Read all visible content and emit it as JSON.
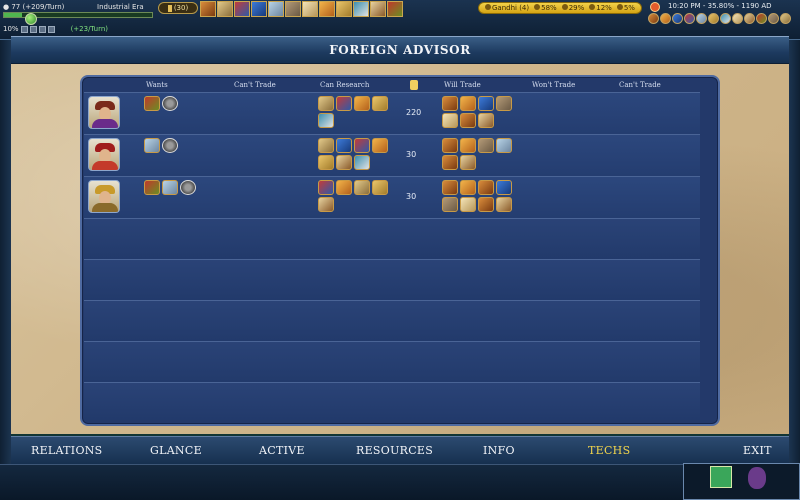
{
  "top_hud": {
    "gold_line": "77 (+209/Turn)",
    "era": "Industrial Era",
    "culture_percent": "10%",
    "culture_rate": "(+23/Turn)",
    "research_turns": "(30)",
    "resource_bar": {
      "civ": "Gandhi (4)",
      "gold_rate": "58%",
      "science_rate": "29%",
      "culture_rate": "12%",
      "espionage_rate": "5%"
    },
    "clock": "10:20 PM - 35.80% - 1190 AD"
  },
  "window": {
    "title": "FOREIGN ADVISOR"
  },
  "headers": {
    "wants": "Wants",
    "cant_trade": "Can't Trade",
    "can_research": "Can Research",
    "will_trade": "Will Trade",
    "wont_trade": "Won't Trade",
    "cant_trade_2": "Can't Trade"
  },
  "leaders": [
    {
      "portrait": "leader-portrait-1",
      "wants": [
        "apple-icon",
        "compass-icon"
      ],
      "can_research": [
        "columns-icon",
        "flag-icon",
        "bread-icon",
        "wheat-icon",
        "fish-icon"
      ],
      "gold": "220",
      "will_trade": [
        "horse-icon",
        "bread-icon",
        "shield-icon",
        "stone-icon",
        "scroll-icon",
        "horse-icon",
        "compass-icon"
      ]
    },
    {
      "portrait": "leader-portrait-2",
      "wants": [
        "gears-icon",
        "compass-icon"
      ],
      "can_research": [
        "columns-icon",
        "shield-icon",
        "flag-icon",
        "bread-icon",
        "wheat-icon",
        "compass-icon",
        "fish-icon"
      ],
      "gold": "30",
      "will_trade": [
        "horse-icon",
        "bread-icon",
        "stone-icon",
        "gears-icon",
        "horse-icon",
        "compass-icon"
      ]
    },
    {
      "portrait": "leader-portrait-3",
      "wants": [
        "apple-icon",
        "gears-icon",
        "compass-icon"
      ],
      "can_research": [
        "flag-icon",
        "bread-icon",
        "columns-icon",
        "wheat-icon",
        "compass-icon"
      ],
      "gold": "30",
      "will_trade": [
        "horse-icon",
        "bread-icon",
        "horse-icon",
        "shield-icon",
        "stone-icon",
        "scroll-icon",
        "horse-icon",
        "compass-icon"
      ]
    }
  ],
  "tabs": [
    {
      "label": "RELATIONS",
      "active": false
    },
    {
      "label": "GLANCE",
      "active": false
    },
    {
      "label": "ACTIVE",
      "active": false
    },
    {
      "label": "RESOURCES",
      "active": false
    },
    {
      "label": "INFO",
      "active": false
    },
    {
      "label": "TECHS",
      "active": true
    },
    {
      "label": "EXIT",
      "active": false
    }
  ],
  "colors": {
    "active_tab": "#f1d44c",
    "board": "#23396a",
    "parchment": "#d8c39c"
  }
}
